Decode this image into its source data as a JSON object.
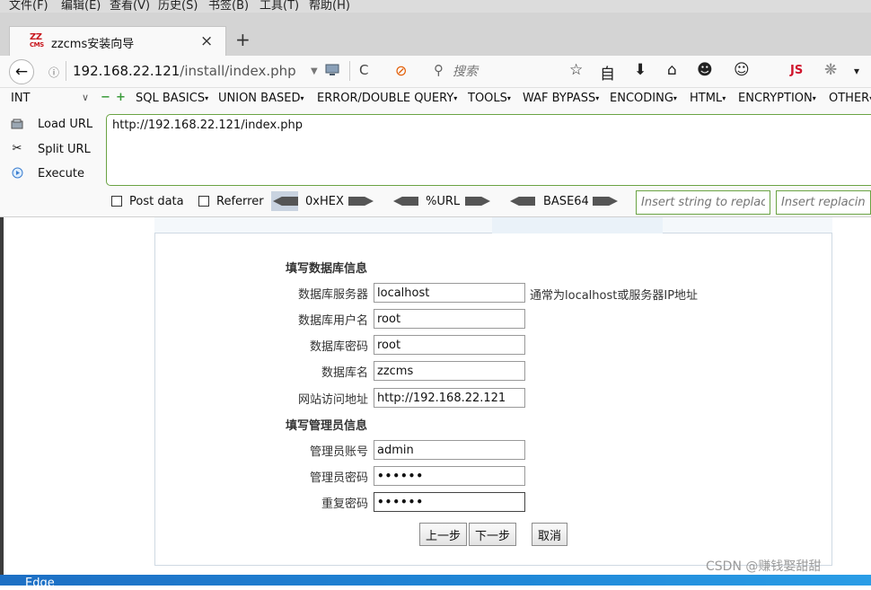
{
  "menubar": {
    "items": [
      "文件(F)",
      "编辑(E)",
      "查看(V)",
      "历史(S)",
      "书签(B)",
      "工具(T)",
      "帮助(H)"
    ]
  },
  "tab": {
    "logo_top": "ZZ",
    "logo_bottom": "CMS",
    "title": "zzcms安装向导",
    "close": "×",
    "new_tab": "+"
  },
  "nav": {
    "back": "←",
    "info": "ⓘ",
    "url_host": "192.168.22.121",
    "url_path": "/install/index.php",
    "search_placeholder": "搜索",
    "dropdown": "▼",
    "reload": "C",
    "stop": "⊘",
    "search_icon": "⚲",
    "toolbar_icons": [
      "☆",
      "自",
      "⬇",
      "⌂",
      "☻",
      "☺",
      "JS",
      "❋",
      "▾"
    ]
  },
  "hackbar": {
    "select_value": "INT",
    "select_chevron": "∨",
    "minus": "−",
    "plus": "+",
    "menus": [
      "SQL BASICS",
      "UNION BASED",
      "ERROR/DOUBLE QUERY",
      "TOOLS",
      "WAF BYPASS",
      "ENCODING",
      "HTML",
      "ENCRYPTION",
      "OTHER"
    ],
    "load_url": "Load URL",
    "split_url": "Split URL",
    "execute": "Execute",
    "url_value": "http://192.168.22.121/index.php",
    "post_data": "Post data",
    "referrer": "Referrer",
    "hex": "0xHEX",
    "url_enc": "%URL",
    "base64": "BASE64",
    "replace_placeholder": "Insert string to replace",
    "replacing_placeholder": "Insert replacing string"
  },
  "form": {
    "db_section": "填写数据库信息",
    "admin_section": "填写管理员信息",
    "db_fields": [
      {
        "label": "数据库服务器",
        "value": "localhost"
      },
      {
        "label": "数据库用户名",
        "value": "root"
      },
      {
        "label": "数据库密码",
        "value": "root"
      },
      {
        "label": "数据库名",
        "value": "zzcms"
      },
      {
        "label": "网站访问地址",
        "value": "http://192.168.22.121"
      }
    ],
    "host_hint": "通常为localhost或服务器IP地址",
    "admin_fields": [
      {
        "label": "管理员账号",
        "value": "admin"
      },
      {
        "label": "管理员密码",
        "value": "••••••"
      },
      {
        "label": "重复密码",
        "value": "••••••"
      }
    ],
    "buttons": {
      "prev": "上一步",
      "next": "下一步",
      "cancel": "取消"
    }
  },
  "taskbar": {
    "label": "Edge"
  },
  "watermark": "CSDN @赚钱娶甜甜",
  "colors": {
    "accent_green": "#6aa343",
    "taskbar_blue": "#1f88d8",
    "stop_orange": "#e25a00"
  }
}
